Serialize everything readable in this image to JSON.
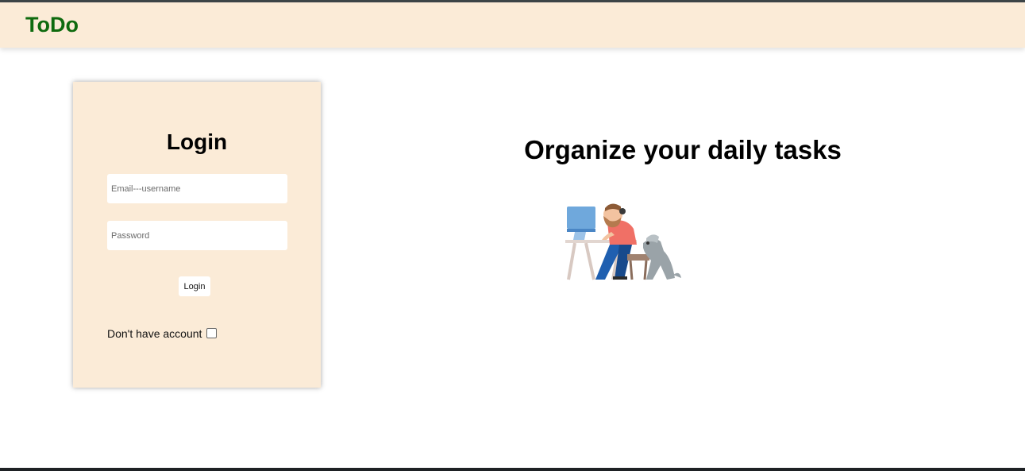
{
  "navbar": {
    "brand": "ToDo"
  },
  "login": {
    "title": "Login",
    "email_placeholder": "Email---username",
    "password_placeholder": "Password",
    "submit_label": "Login",
    "account_label": "Don't have account"
  },
  "hero": {
    "title": "Organize your daily tasks",
    "illustration": "person-at-desk-with-dog-illustration"
  },
  "colors": {
    "brand_green": "#0e6a0e",
    "panel_beige": "#fbebd7"
  }
}
